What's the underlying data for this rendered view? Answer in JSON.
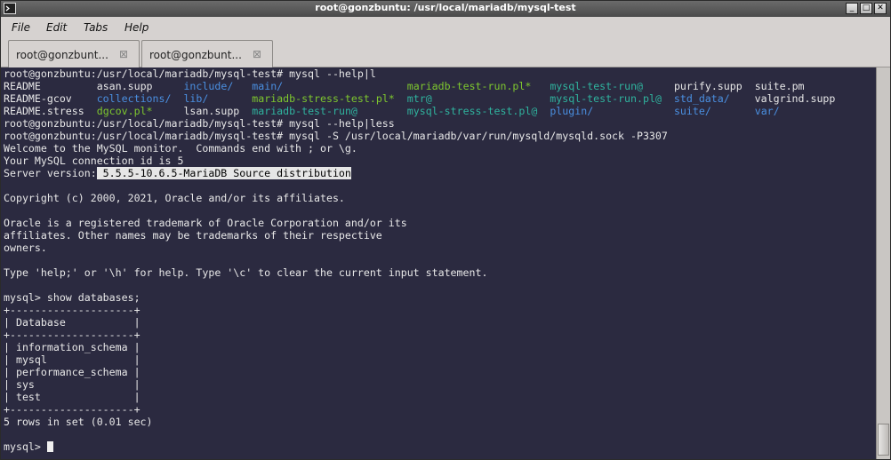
{
  "window": {
    "title": "root@gonzbuntu: /usr/local/mariadb/mysql-test",
    "minimize": "_",
    "maximize": "□",
    "close": "✕"
  },
  "menu": {
    "file": "File",
    "edit": "Edit",
    "tabs": "Tabs",
    "help": "Help"
  },
  "tabs": [
    {
      "label": "root@gonzbunt...",
      "close": "⊠"
    },
    {
      "label": "root@gonzbunt...",
      "close": "⊠"
    }
  ],
  "terminal": {
    "l1": "root@gonzbuntu:/usr/local/mariadb/mysql-test# mysql --help|l",
    "ls": [
      [
        "README",
        "asan.supp",
        "include/",
        "main/",
        "mariadb-test-run.pl*",
        "mysql-test-run@",
        "purify.supp",
        "suite.pm"
      ],
      [
        "README-gcov",
        "collections/",
        "lib/",
        "mariadb-stress-test.pl*",
        "mtr@",
        "mysql-test-run.pl@",
        "std_data/",
        "valgrind.supp"
      ],
      [
        "README.stress",
        "dgcov.pl*",
        "lsan.supp",
        "mariadb-test-run@",
        "mysql-stress-test.pl@",
        "plugin/",
        "suite/",
        "var/"
      ]
    ],
    "l5": "root@gonzbuntu:/usr/local/mariadb/mysql-test# mysql --help|less",
    "l6": "root@gonzbuntu:/usr/local/mariadb/mysql-test# mysql -S /usr/local/mariadb/var/run/mysqld/mysqld.sock -P3307",
    "l7": "Welcome to the MySQL monitor.  Commands end with ; or \\g.",
    "l8": "Your MySQL connection id is 5",
    "l9_prefix": "Server version:",
    "l9_value": " 5.5.5-10.6.5-MariaDB Source distribution",
    "l11": "Copyright (c) 2000, 2021, Oracle and/or its affiliates.",
    "l13": "Oracle is a registered trademark of Oracle Corporation and/or its",
    "l14": "affiliates. Other names may be trademarks of their respective",
    "l15": "owners.",
    "l17": "Type 'help;' or '\\h' for help. Type '\\c' to clear the current input statement.",
    "l19": "mysql> show databases;",
    "t_border": "+--------------------+",
    "t_header": "| Database           |",
    "t_rows": [
      "| information_schema |",
      "| mysql              |",
      "| performance_schema |",
      "| sys                |",
      "| test               |"
    ],
    "result": "5 rows in set (0.01 sec)",
    "prompt": "mysql> "
  },
  "colors": {
    "terminal_bg": "#2b2a40",
    "dir_blue": "#4a8fe0",
    "exec_green": "#7ec72e",
    "link_teal": "#2fb39e"
  }
}
